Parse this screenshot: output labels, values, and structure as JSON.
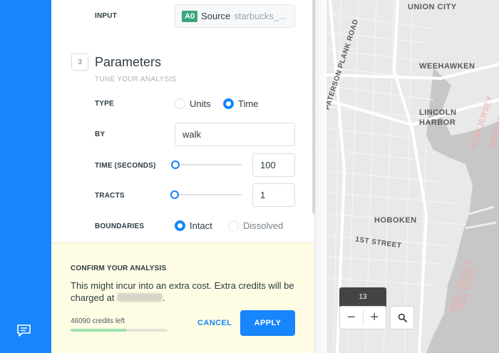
{
  "input": {
    "label": "INPUT",
    "node_id": "A0",
    "source_word": "Source",
    "source_name": "starbucks_..."
  },
  "parameters": {
    "step": "3",
    "title": "Parameters",
    "subtitle": "TUNE YOUR ANALYSIS",
    "type": {
      "label": "TYPE",
      "options": [
        "Units",
        "Time"
      ],
      "selected": "Time"
    },
    "by": {
      "label": "BY",
      "value": "walk"
    },
    "time": {
      "label": "TIME (SECONDS)",
      "value": "100",
      "slider_fraction": 0
    },
    "tracts": {
      "label": "TRACTS",
      "value": "1",
      "slider_fraction": 0
    },
    "boundaries": {
      "label": "BOUNDARIES",
      "options": [
        "Intact",
        "Dissolved"
      ],
      "selected": "Intact"
    }
  },
  "confirm": {
    "title": "CONFIRM YOUR ANALYSIS",
    "body_prefix": "This might incur into an extra cost. Extra credits will be charged at",
    "body_suffix": ".",
    "credits_left": "46090 credits left",
    "credits_fraction": 0.57,
    "cancel_label": "CANCEL",
    "apply_label": "APPLY"
  },
  "map": {
    "labels": {
      "union_city": "UNION CITY",
      "paterson_plank_road": "PATERSON PLANK ROAD",
      "weehawken": "WEEHAWKEN",
      "lincoln_harbor": "LINCOLN HARBOR",
      "hoboken": "HOBOKEN",
      "first_street": "1ST STREET",
      "new_jersey_1": "NEW JERSEY",
      "new_jersey_2": "NEW JERSEY",
      "new_york_1": "NEW YORK",
      "new_york_2": "NEW YORK"
    },
    "zoom_level": "13",
    "zoom_out": "−",
    "zoom_in": "+"
  },
  "colors": {
    "accent": "#1785fb",
    "confirm_bg": "#fffce4",
    "node_badge": "#3aa77b",
    "credits_bar": "#9de0ad"
  },
  "icons": {
    "rail": "chat-icon",
    "map_search": "search-icon"
  }
}
